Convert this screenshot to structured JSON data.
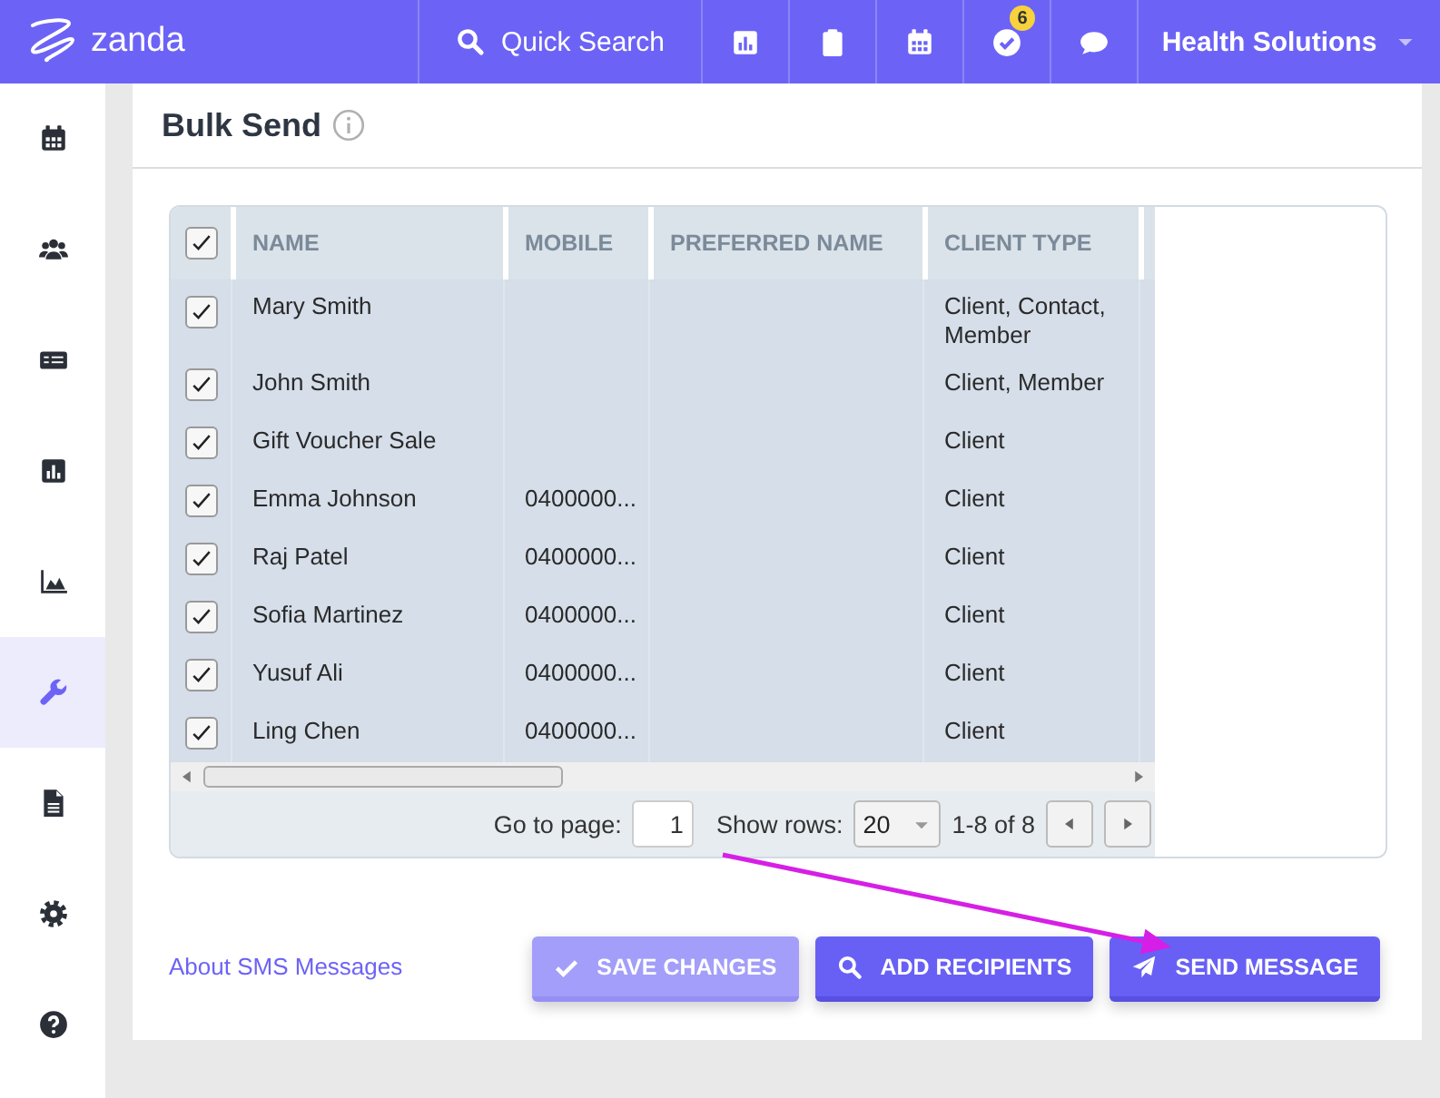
{
  "topbar": {
    "brand": "zanda",
    "search_label": "Quick Search",
    "icons": [
      {
        "kind": "bar"
      },
      {
        "kind": "clipboard"
      },
      {
        "kind": "calendar"
      },
      {
        "kind": "check-circle",
        "badge": "6"
      },
      {
        "kind": "chat"
      }
    ],
    "account": "Health Solutions"
  },
  "sidebar": {
    "items": [
      {
        "kind": "calendar",
        "selected": false
      },
      {
        "kind": "users",
        "selected": false
      },
      {
        "kind": "card",
        "selected": false
      },
      {
        "kind": "bar",
        "selected": false
      },
      {
        "kind": "area",
        "selected": false
      },
      {
        "kind": "wrench",
        "selected": true
      },
      {
        "kind": "document",
        "selected": false
      },
      {
        "kind": "gear",
        "selected": false
      },
      {
        "kind": "help",
        "selected": false
      }
    ]
  },
  "page": {
    "title": "Bulk Send"
  },
  "table": {
    "all_checked": true,
    "columns": [
      "NAME",
      "MOBILE",
      "PREFERRED NAME",
      "CLIENT TYPE"
    ],
    "rows": [
      {
        "checked": true,
        "name": "Mary Smith",
        "client_type": "Client, Contact, Member"
      },
      {
        "checked": true,
        "name": "John Smith",
        "client_type": "Client, Member"
      },
      {
        "checked": true,
        "name": "Gift Voucher Sale",
        "client_type": "Client"
      },
      {
        "checked": true,
        "name": "Emma Johnson",
        "mobile": "0400000...",
        "client_type": "Client"
      },
      {
        "checked": true,
        "name": "Raj Patel",
        "mobile": "0400000...",
        "client_type": "Client"
      },
      {
        "checked": true,
        "name": "Sofia Martinez",
        "mobile": "0400000...",
        "client_type": "Client"
      },
      {
        "checked": true,
        "name": "Yusuf Ali",
        "mobile": "0400000...",
        "client_type": "Client"
      },
      {
        "checked": true,
        "name": "Ling Chen",
        "mobile": "0400000...",
        "client_type": "Client"
      }
    ],
    "pager": {
      "go_to_label": "Go to page:",
      "page": "1",
      "show_rows_label": "Show rows:",
      "rows_per_page": "20",
      "range": "1-8 of 8"
    }
  },
  "footer": {
    "link": "About SMS Messages",
    "buttons": [
      {
        "kind": "check",
        "label": "SAVE CHANGES",
        "disabled": true
      },
      {
        "kind": "search",
        "label": "ADD RECIPIENTS",
        "disabled": false
      },
      {
        "kind": "send",
        "label": "SEND MESSAGE",
        "disabled": false
      }
    ]
  }
}
